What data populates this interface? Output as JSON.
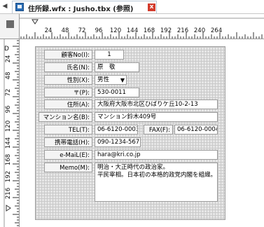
{
  "tab": {
    "title": "住所録.wfx : Jusho.tbx (参照)",
    "close_glyph": "x",
    "scroll_glyph": "◀"
  },
  "ruler": {
    "h_ticks": [
      "24",
      "48",
      "72",
      "96",
      "120",
      "144",
      "168",
      "192",
      "216",
      "240",
      "264"
    ],
    "v_ticks": [
      "24",
      "48",
      "72",
      "96",
      "120",
      "144",
      "168",
      "192",
      "216"
    ],
    "v_origin_label": "D"
  },
  "form": {
    "fields": [
      {
        "label": "顧客No(I):",
        "value": "1"
      },
      {
        "label": "氏名(N):",
        "value": "原　敬"
      },
      {
        "label": "性別(X):",
        "value": "男性"
      },
      {
        "label": "〒(P):",
        "value": "530-0011"
      },
      {
        "label": "住所(A):",
        "value": "大阪府大阪市北区ひばりケ丘10-2-13"
      },
      {
        "label": "マンション名(B):",
        "value": "マンション鈴木409号"
      },
      {
        "label": "TEL(T):",
        "value": "06-6120-0003"
      },
      {
        "label": "FAX(F):",
        "value": "06-6120-0004"
      },
      {
        "label": "携帯電話(H):",
        "value": "090-1234-5671"
      },
      {
        "label": "e-MaiL(E):",
        "value": "hara@kri.co.jp"
      },
      {
        "label": "Memo(M):",
        "value": "明治・大正時代の政治家。\n平民宰相。日本初の本格的政党内閣を組織。"
      }
    ],
    "combo_arrow": "▼"
  }
}
